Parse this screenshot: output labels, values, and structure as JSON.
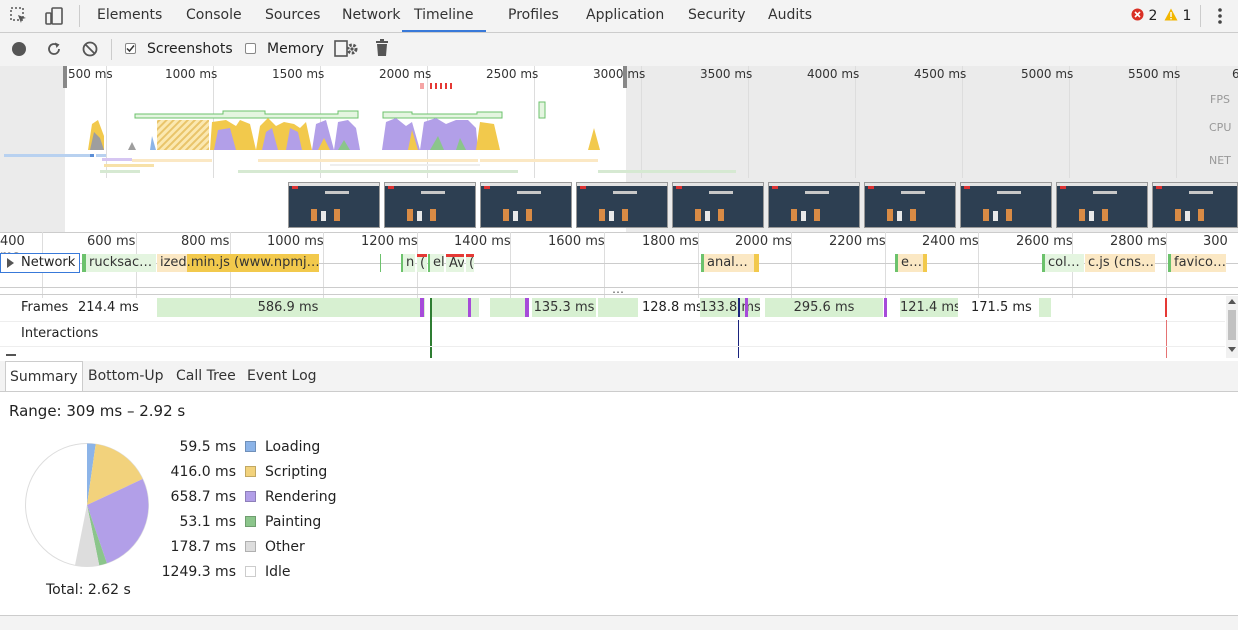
{
  "tabs": [
    "Elements",
    "Console",
    "Sources",
    "Network",
    "Timeline",
    "Profiles",
    "Application",
    "Security",
    "Audits"
  ],
  "status": {
    "errors": "2",
    "warnings": "1"
  },
  "toolbar": {
    "screenshots_label": "Screenshots",
    "memory_label": "Memory"
  },
  "overview": {
    "ruler": [
      "500 ms",
      "1000 ms",
      "1500 ms",
      "2000 ms",
      "2500 ms",
      "3000 ms",
      "3500 ms",
      "4000 ms",
      "4500 ms",
      "5000 ms",
      "5500 ms",
      "6"
    ],
    "lanes": {
      "fps": "FPS",
      "cpu": "CPU",
      "net": "NET"
    }
  },
  "detail": {
    "ruler": [
      "400 ms",
      "600 ms",
      "800 ms",
      "1000 ms",
      "1200 ms",
      "1400 ms",
      "1600 ms",
      "1800 ms",
      "2000 ms",
      "2200 ms",
      "2400 ms",
      "2600 ms",
      "2800 ms",
      "300"
    ],
    "network_label": "Network",
    "network_items": [
      "rucksac…",
      "ized.min.js (www.npmj…",
      "n",
      "(",
      "el",
      "Av",
      "(",
      "anal…",
      "e…",
      "col…",
      "c.js (cns…",
      "favico…"
    ],
    "more": "…",
    "frames_label": "Frames",
    "frames": [
      "214.4 ms",
      "586.9 ms",
      "135.3 ms",
      "128.8 ms",
      "133.8 ms",
      "295.6 ms",
      "121.4 ms",
      "171.5 ms"
    ],
    "interactions_label": "Interactions"
  },
  "bottom_tabs": [
    "Summary",
    "Bottom-Up",
    "Call Tree",
    "Event Log"
  ],
  "summary": {
    "range": "Range: 309 ms – 2.92 s",
    "total": "Total: 2.62 s",
    "legend": [
      {
        "value": "59.5 ms",
        "label": "Loading",
        "color": "#8cb4e8"
      },
      {
        "value": "416.0 ms",
        "label": "Scripting",
        "color": "#f2d27c"
      },
      {
        "value": "658.7 ms",
        "label": "Rendering",
        "color": "#b29fe8"
      },
      {
        "value": "53.1 ms",
        "label": "Painting",
        "color": "#8bc58b"
      },
      {
        "value": "178.7 ms",
        "label": "Other",
        "color": "#dddddd"
      },
      {
        "value": "1249.3 ms",
        "label": "Idle",
        "color": "#ffffff"
      }
    ]
  },
  "colors": {
    "accent": "#3879d9",
    "error": "#d93025",
    "warning": "#f2b600",
    "frame_bg": "#d7f0d1"
  }
}
